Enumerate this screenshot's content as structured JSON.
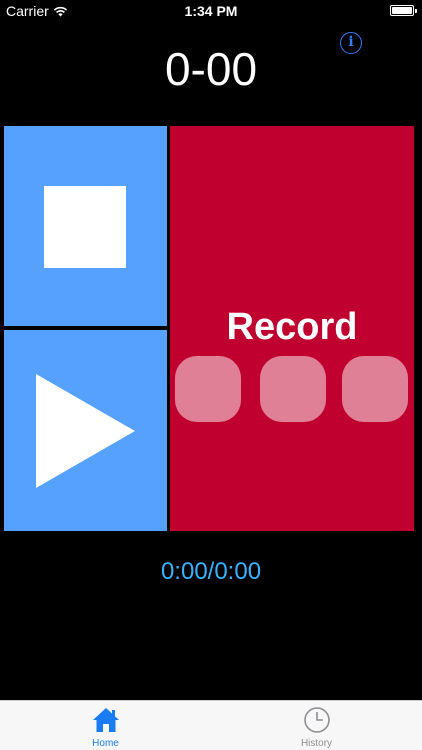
{
  "status_bar": {
    "carrier": "Carrier",
    "time": "1:34 PM",
    "battery_level": 100
  },
  "header": {
    "counter": "0-00",
    "info_icon": "info-icon",
    "info_glyph": "i",
    "accent_color": "#2f7cff"
  },
  "controls": {
    "stop_icon": "stop-icon",
    "play_icon": "play-icon",
    "record_label": "Record",
    "record_dots_icon": "ellipsis-icon",
    "pad_blue": "#57a1fe",
    "pad_red": "#c0002f"
  },
  "playback": {
    "time_readout": "0:00/0:00",
    "readout_color": "#35b3ff"
  },
  "tab_bar": {
    "tabs": [
      {
        "label": "Home",
        "icon": "home-icon",
        "selected": true
      },
      {
        "label": "History",
        "icon": "clock-icon",
        "selected": false
      }
    ],
    "selected_color": "#1a7cf5",
    "unselected_color": "#8e8e93"
  }
}
